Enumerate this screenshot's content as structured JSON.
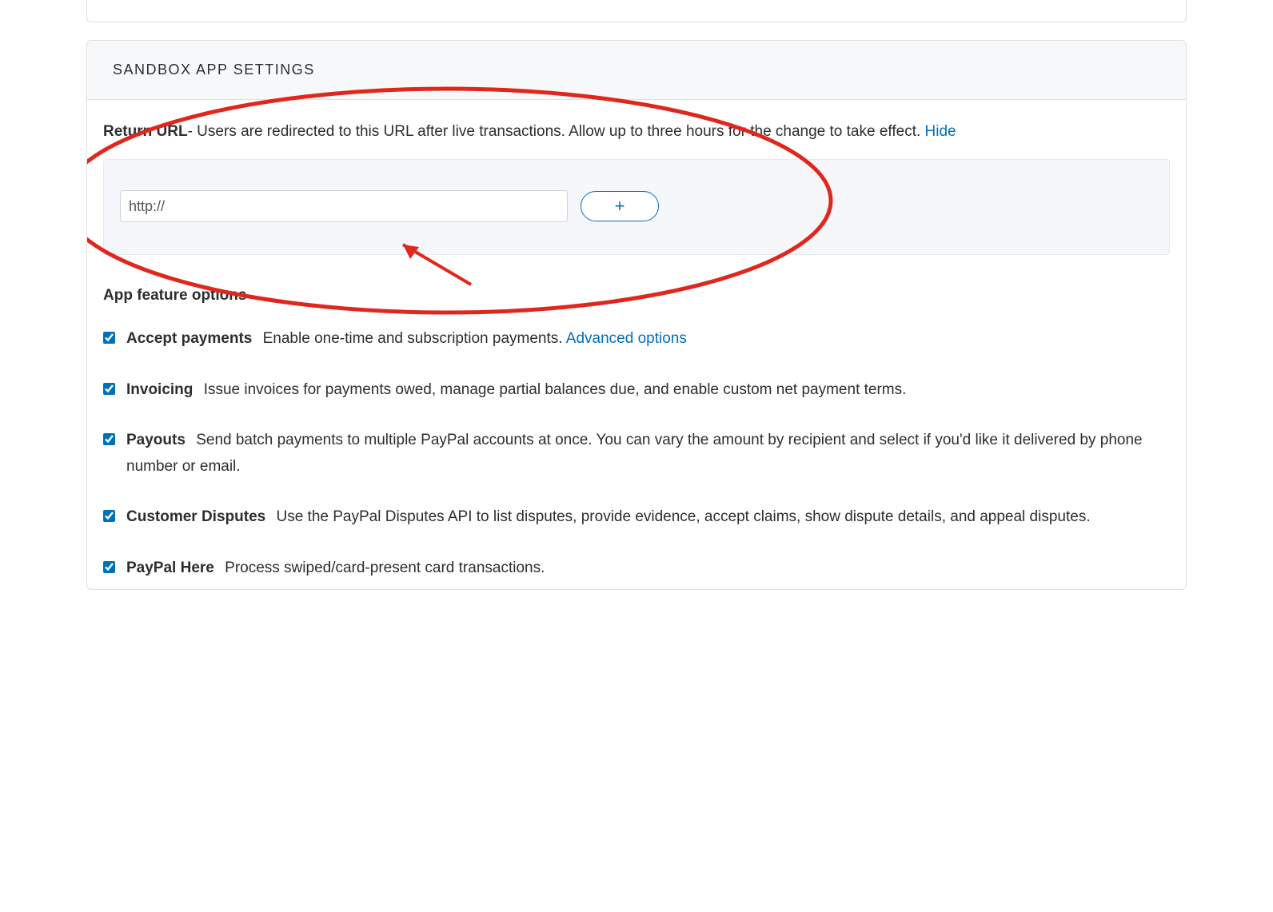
{
  "header": {
    "title": "SANDBOX APP SETTINGS"
  },
  "returnUrl": {
    "label": "Return URL",
    "description": "- Users are redirected to this URL after live transactions. Allow up to three hours for the change to take effect. ",
    "toggleLink": "Hide",
    "inputValue": "http://",
    "addButtonLabel": "+"
  },
  "featuresHeading": "App feature options",
  "features": [
    {
      "checked": true,
      "label": "Accept payments",
      "description": "Enable one-time and subscription payments. ",
      "linkText": "Advanced options"
    },
    {
      "checked": true,
      "label": "Invoicing",
      "description": "Issue invoices for payments owed, manage partial balances due, and enable custom net payment terms."
    },
    {
      "checked": true,
      "label": "Payouts",
      "description": "Send batch payments to multiple PayPal accounts at once. You can vary the amount by recipient and select if you'd like it delivered by phone number or email."
    },
    {
      "checked": true,
      "label": "Customer Disputes",
      "description": "Use the PayPal Disputes API to list disputes, provide evidence, accept claims, show dispute details, and appeal disputes."
    },
    {
      "checked": true,
      "label": "PayPal Here",
      "description": "Process swiped/card-present card transactions."
    }
  ]
}
